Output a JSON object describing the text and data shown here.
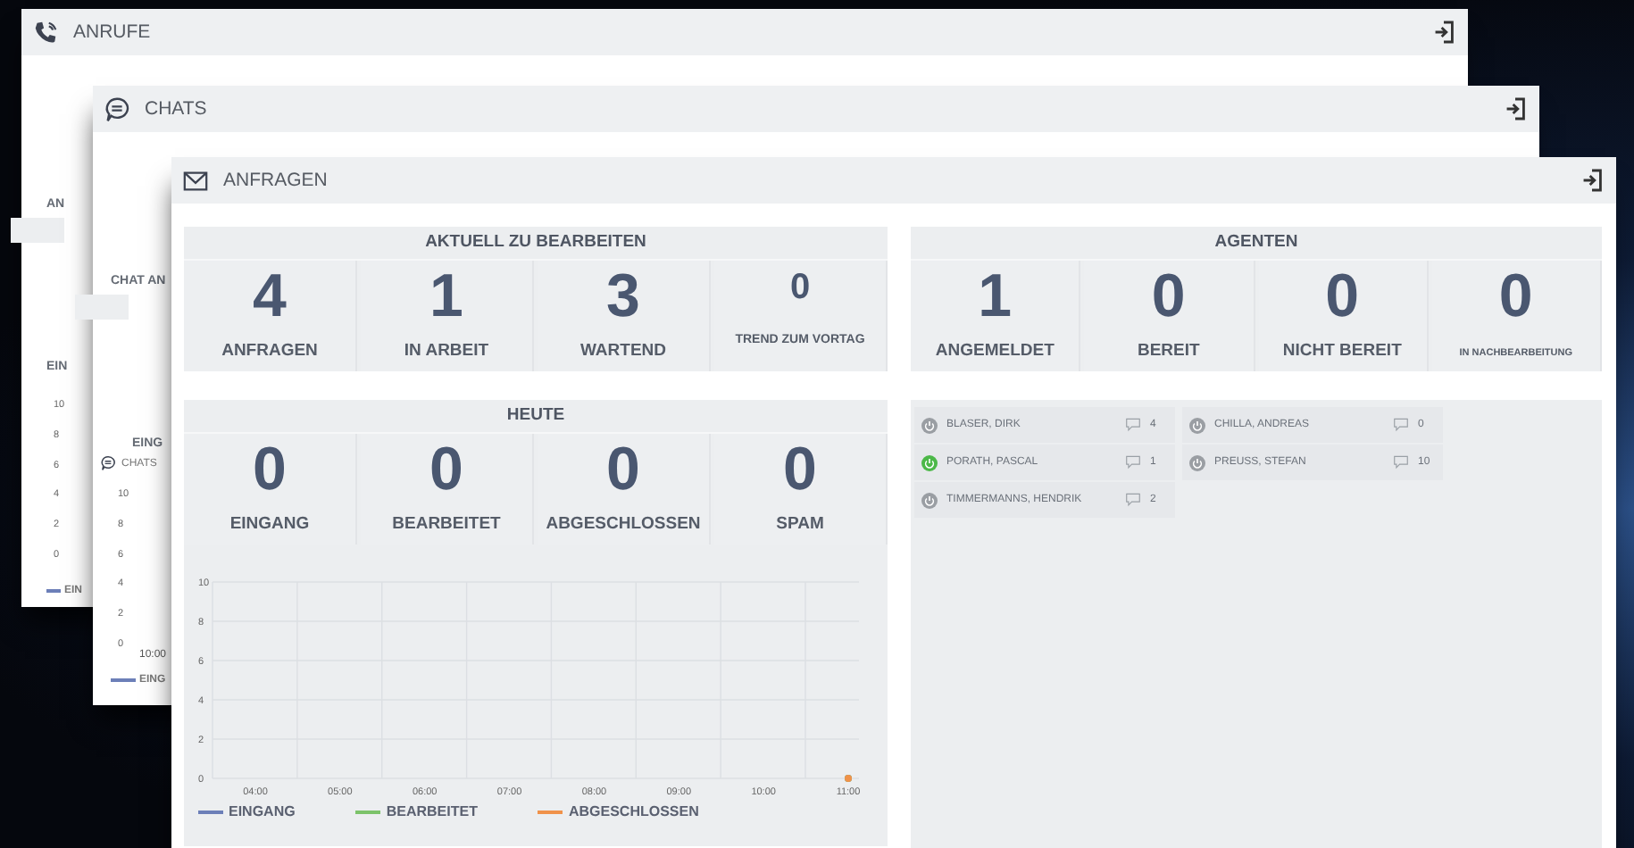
{
  "back_windows": [
    {
      "title": "ANRUFE",
      "labels": [
        "AN",
        "EIN"
      ],
      "ticks": [
        "10",
        "8",
        "6",
        "4",
        "2",
        "0"
      ],
      "legend": {
        "label": "EIN",
        "color": "#6c7fb8"
      }
    },
    {
      "title": "CHATS",
      "labels": [
        "CHAT AN",
        "EING"
      ],
      "chart_title": "CHATS",
      "ticks": [
        "10",
        "8",
        "6",
        "4",
        "2",
        "0"
      ],
      "x_tick": "10:00",
      "legend": {
        "label": "EING",
        "color": "#6c7fb8"
      }
    }
  ],
  "window": {
    "title": "ANFRAGEN"
  },
  "current": {
    "title": "AKTUELL ZU BEARBEITEN",
    "stats": [
      {
        "value": "4",
        "label": "ANFRAGEN",
        "kind": "large"
      },
      {
        "value": "1",
        "label": "IN ARBEIT",
        "kind": "large"
      },
      {
        "value": "3",
        "label": "WARTEND",
        "kind": "large"
      },
      {
        "value": "0",
        "label": "TREND ZUM VORTAG",
        "kind": "small"
      }
    ]
  },
  "agents": {
    "title": "AGENTEN",
    "stats": [
      {
        "value": "1",
        "label": "ANGEMELDET",
        "kind": "large"
      },
      {
        "value": "0",
        "label": "BEREIT",
        "kind": "large"
      },
      {
        "value": "0",
        "label": "NICHT BEREIT",
        "kind": "large"
      },
      {
        "value": "0",
        "label": "IN NACHBEARBEITUNG",
        "kind": "tiny"
      }
    ]
  },
  "today": {
    "title": "HEUTE",
    "stats": [
      {
        "value": "0",
        "label": "EINGANG",
        "kind": "large"
      },
      {
        "value": "0",
        "label": "BEARBEITET",
        "kind": "large"
      },
      {
        "value": "0",
        "label": "ABGESCHLOSSEN",
        "kind": "large"
      },
      {
        "value": "0",
        "label": "SPAM",
        "kind": "large"
      }
    ],
    "chart_data": {
      "type": "line",
      "categories": [
        "04:00",
        "05:00",
        "06:00",
        "07:00",
        "08:00",
        "09:00",
        "10:00",
        "11:00"
      ],
      "ylim": [
        0,
        10
      ],
      "yticks": [
        0,
        2,
        4,
        6,
        8,
        10
      ],
      "grid": true,
      "series": [
        {
          "name": "EINGANG",
          "color": "#6c7fb8",
          "marker": true,
          "values": [
            null,
            null,
            null,
            null,
            null,
            null,
            null,
            0
          ]
        },
        {
          "name": "BEARBEITET",
          "color": "#7cc36a",
          "marker": true,
          "values": [
            null,
            null,
            null,
            null,
            null,
            null,
            null,
            0
          ]
        },
        {
          "name": "ABGESCHLOSSEN",
          "color": "#f0924a",
          "marker": true,
          "values": [
            null,
            null,
            null,
            null,
            null,
            null,
            null,
            0
          ]
        }
      ]
    }
  },
  "agent_columns": [
    [
      {
        "name": "BLASER, DIRK",
        "count": "4",
        "color": "#9a9ea3"
      },
      {
        "name": "PORATH, PASCAL",
        "count": "1",
        "color": "#4cb848"
      },
      {
        "name": "TIMMERMANNS, HENDRIK",
        "count": "2",
        "color": "#9a9ea3"
      }
    ],
    [
      {
        "name": "CHILLA, ANDREAS",
        "count": "0",
        "color": "#9a9ea3"
      },
      {
        "name": "PREUSS, STEFAN",
        "count": "10",
        "color": "#9a9ea3"
      }
    ]
  ]
}
